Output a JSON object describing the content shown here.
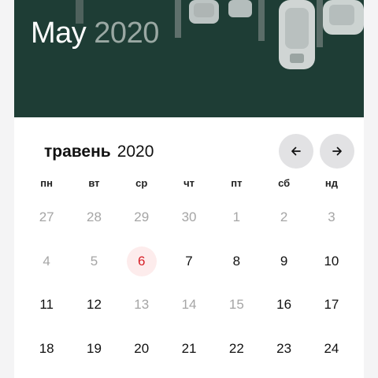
{
  "hero": {
    "month": "May",
    "year": "2020"
  },
  "calendar": {
    "month_name": "травень",
    "year": "2020",
    "prev_icon": "arrow-left-icon",
    "next_icon": "arrow-right-icon",
    "weekdays": [
      "пн",
      "вт",
      "ср",
      "чт",
      "пт",
      "сб",
      "нд"
    ],
    "days": [
      {
        "label": "27",
        "muted": true
      },
      {
        "label": "28",
        "muted": true
      },
      {
        "label": "29",
        "muted": true
      },
      {
        "label": "30",
        "muted": true
      },
      {
        "label": "1",
        "muted": true
      },
      {
        "label": "2",
        "muted": true
      },
      {
        "label": "3",
        "muted": true
      },
      {
        "label": "4",
        "muted": true
      },
      {
        "label": "5",
        "muted": true
      },
      {
        "label": "6",
        "today": true
      },
      {
        "label": "7"
      },
      {
        "label": "8"
      },
      {
        "label": "9"
      },
      {
        "label": "10"
      },
      {
        "label": "11"
      },
      {
        "label": "12"
      },
      {
        "label": "13",
        "muted": true
      },
      {
        "label": "14",
        "muted": true
      },
      {
        "label": "15",
        "muted": true
      },
      {
        "label": "16"
      },
      {
        "label": "17"
      },
      {
        "label": "18"
      },
      {
        "label": "19"
      },
      {
        "label": "20"
      },
      {
        "label": "21"
      },
      {
        "label": "22"
      },
      {
        "label": "23"
      },
      {
        "label": "24"
      }
    ]
  },
  "colors": {
    "hero_bg": "#1d3b33",
    "today_text": "#d61f26",
    "today_bg": "#fdecec",
    "muted_text": "#a5a5a5",
    "nav_button_bg": "#e2e2e4"
  }
}
